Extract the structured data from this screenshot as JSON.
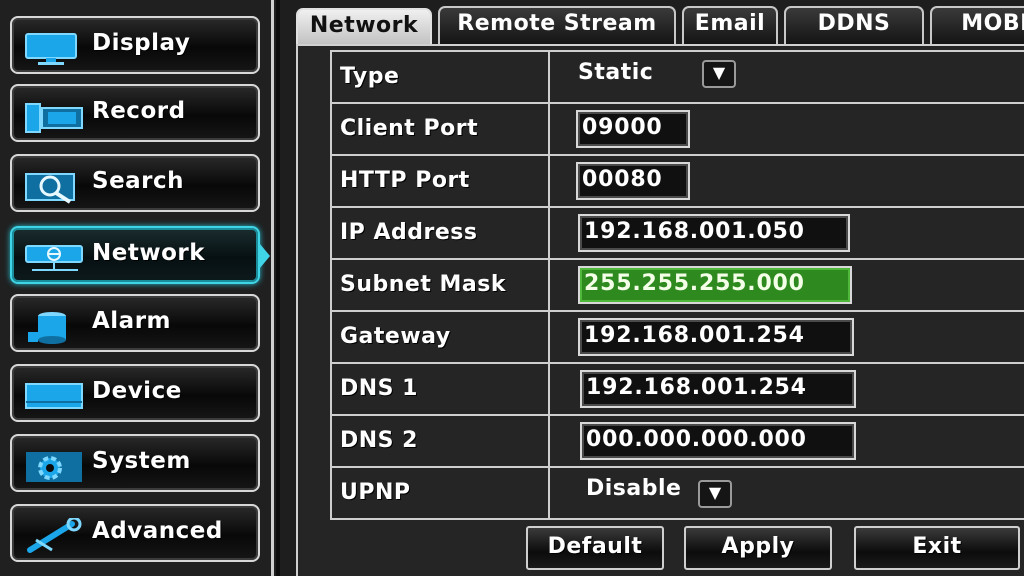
{
  "sidebar": {
    "items": [
      {
        "label": "Display",
        "icon": "display-icon"
      },
      {
        "label": "Record",
        "icon": "record-icon"
      },
      {
        "label": "Search",
        "icon": "search-icon"
      },
      {
        "label": "Network",
        "icon": "network-icon",
        "active": true
      },
      {
        "label": "Alarm",
        "icon": "alarm-icon"
      },
      {
        "label": "Device",
        "icon": "device-icon"
      },
      {
        "label": "System",
        "icon": "gear-icon"
      },
      {
        "label": "Advanced",
        "icon": "wrench-icon"
      }
    ]
  },
  "tabs": [
    {
      "label": "Network",
      "active": true
    },
    {
      "label": "Remote Stream"
    },
    {
      "label": "Email"
    },
    {
      "label": "DDNS"
    },
    {
      "label": "MOBI"
    }
  ],
  "form": {
    "type": {
      "label": "Type",
      "value": "Static"
    },
    "client_port": {
      "label": "Client Port",
      "value": "09000"
    },
    "http_port": {
      "label": "HTTP Port",
      "value": "00080"
    },
    "ip_address": {
      "label": "IP Address",
      "value": "192.168.001.050"
    },
    "subnet_mask": {
      "label": "Subnet Mask",
      "value": "255.255.255.000",
      "focused": true
    },
    "gateway": {
      "label": "Gateway",
      "value": "192.168.001.254"
    },
    "dns1": {
      "label": "DNS 1",
      "value": "192.168.001.254"
    },
    "dns2": {
      "label": "DNS 2",
      "value": "000.000.000.000"
    },
    "upnp": {
      "label": "UPNP",
      "value": "Disable"
    }
  },
  "buttons": {
    "default_label": "Default",
    "apply_label": "Apply",
    "exit_label": "Exit"
  },
  "colors": {
    "accent_active": "#3fd4e6",
    "focus_field": "#2e8a1e",
    "icon_blue": "#1aa6e8"
  }
}
